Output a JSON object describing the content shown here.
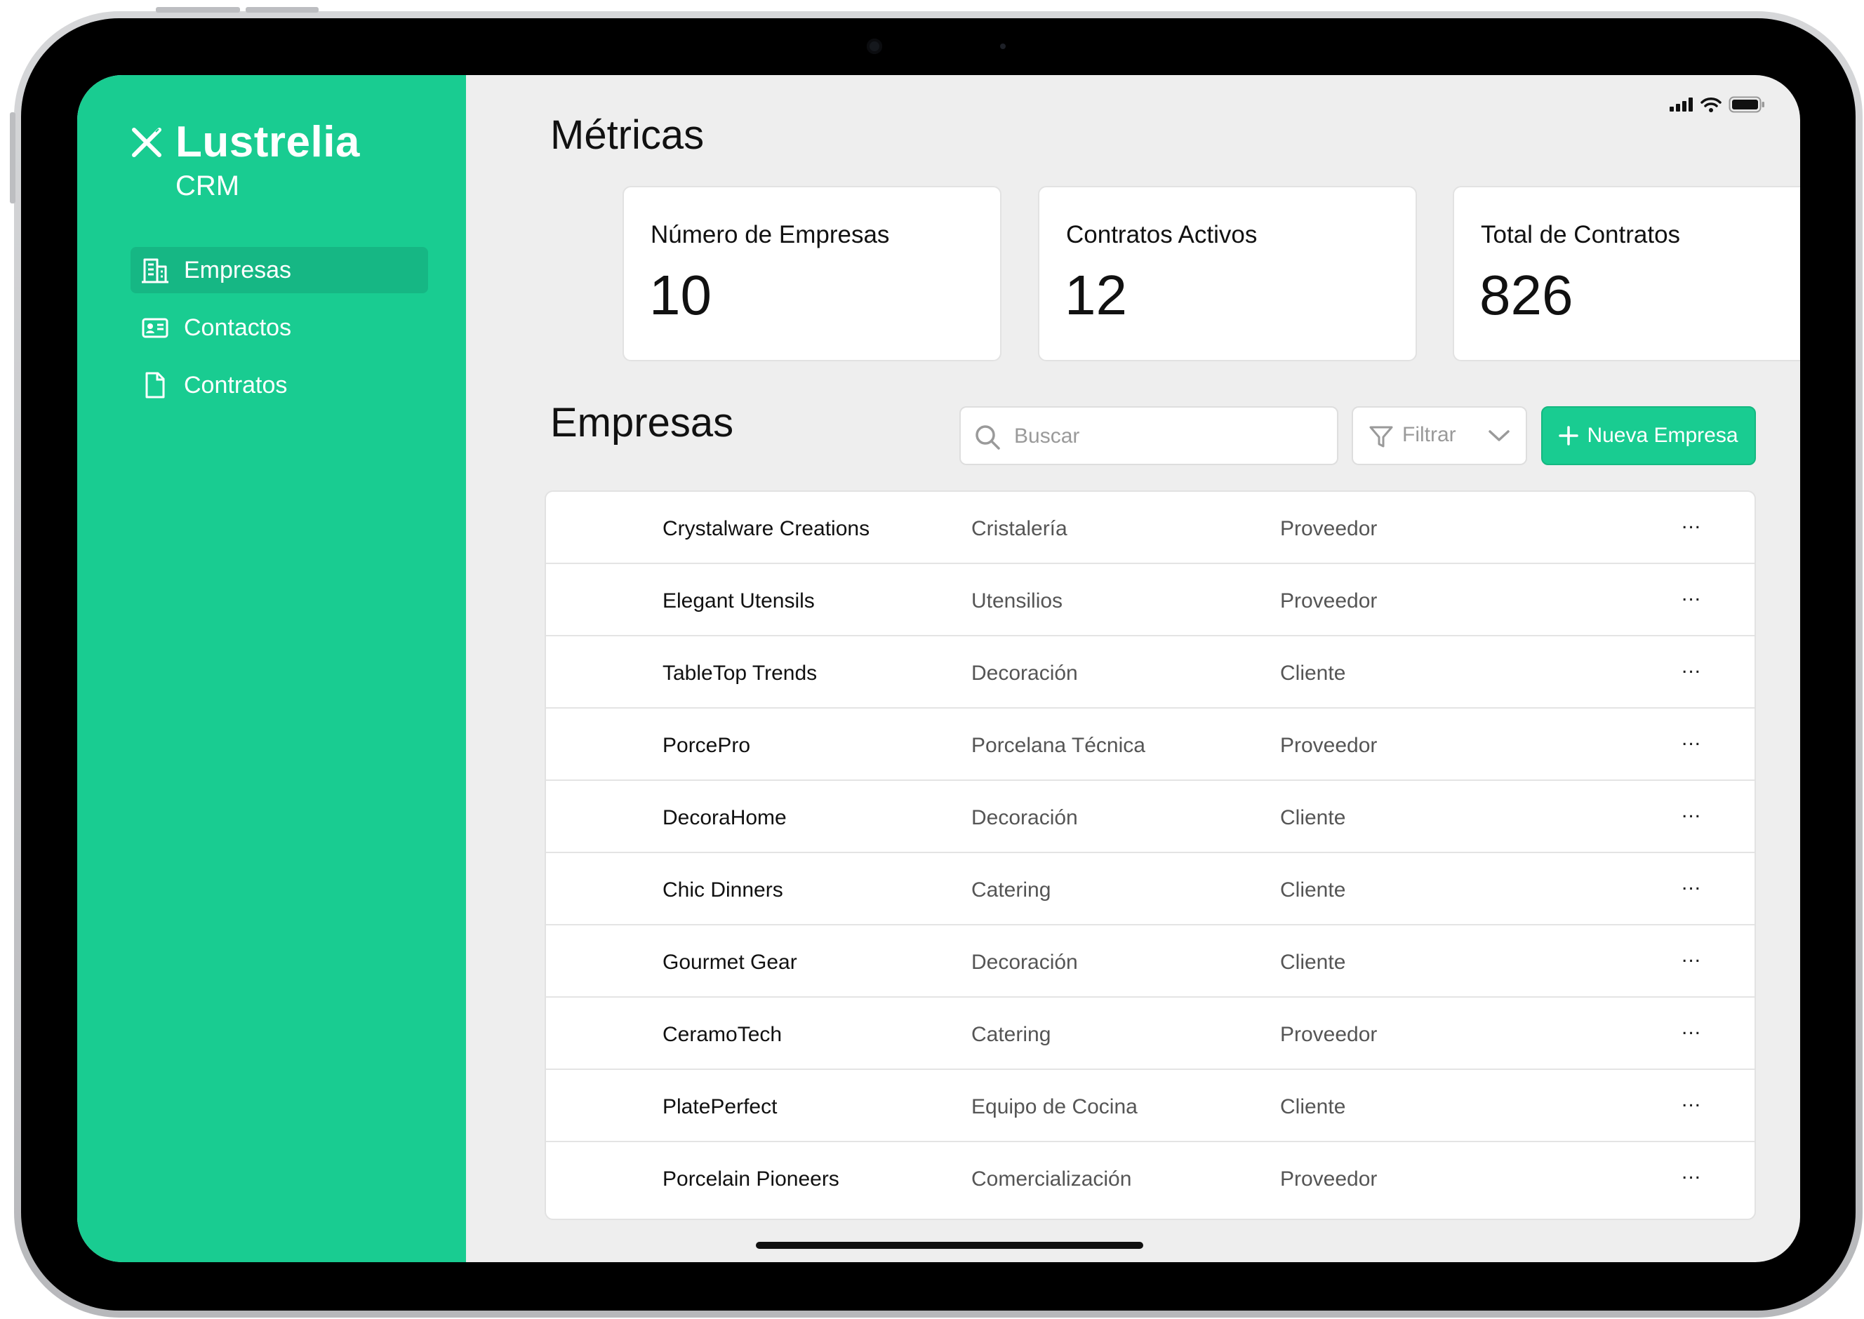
{
  "app": {
    "name": "Lustrelia",
    "subtitle": "CRM"
  },
  "colors": {
    "accent": "#19cc91",
    "accent_dark": "#16b784",
    "background": "#eeeeee"
  },
  "sidebar": {
    "items": [
      {
        "label": "Empresas",
        "icon": "building-icon",
        "active": true
      },
      {
        "label": "Contactos",
        "icon": "contact-card-icon",
        "active": false
      },
      {
        "label": "Contratos",
        "icon": "document-icon",
        "active": false
      }
    ]
  },
  "metrics": {
    "title": "Métricas",
    "cards": [
      {
        "label": "Número de Empresas",
        "value": "10"
      },
      {
        "label": "Contratos Activos",
        "value": "12"
      },
      {
        "label": "Total de Contratos",
        "value": "826"
      }
    ]
  },
  "companies": {
    "title": "Empresas",
    "search_placeholder": "Buscar",
    "filter_label": "Filtrar",
    "new_button_label": "Nueva Empresa",
    "more_label": "...",
    "rows": [
      {
        "name": "Crystalware Creations",
        "category": "Cristalería",
        "type": "Proveedor"
      },
      {
        "name": "Elegant Utensils",
        "category": "Utensilios",
        "type": "Proveedor"
      },
      {
        "name": "TableTop Trends",
        "category": "Decoración",
        "type": "Cliente"
      },
      {
        "name": "PorcePro",
        "category": "Porcelana Técnica",
        "type": "Proveedor"
      },
      {
        "name": "DecoraHome",
        "category": "Decoración",
        "type": "Cliente"
      },
      {
        "name": "Chic Dinners",
        "category": "Catering",
        "type": "Cliente"
      },
      {
        "name": "Gourmet Gear",
        "category": "Decoración",
        "type": "Cliente"
      },
      {
        "name": "CeramoTech",
        "category": "Catering",
        "type": "Proveedor"
      },
      {
        "name": "PlatePerfect",
        "category": "Equipo de Cocina",
        "type": "Cliente"
      },
      {
        "name": "Porcelain Pioneers",
        "category": "Comercialización",
        "type": "Proveedor"
      }
    ]
  }
}
